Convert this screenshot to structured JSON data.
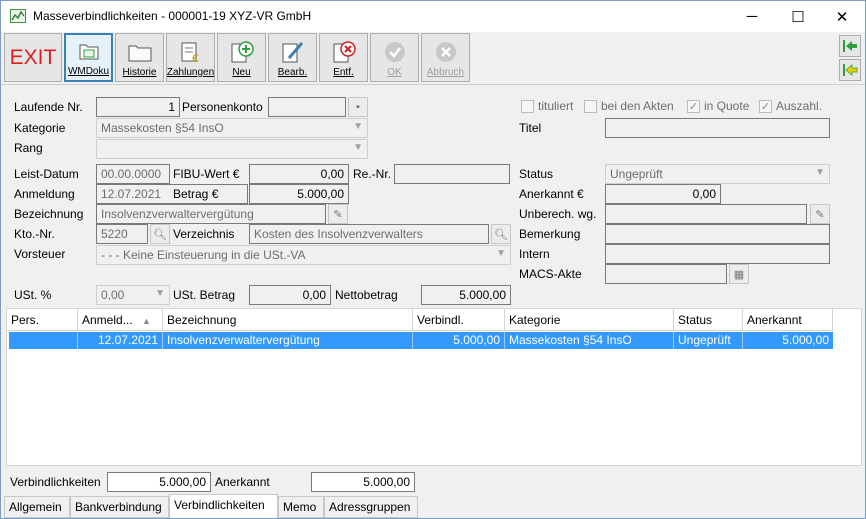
{
  "window": {
    "title": "Masseverbindlichkeiten - 000001-19 XYZ-VR GmbH",
    "minimize": "─",
    "maximize": "☐",
    "close": "✕"
  },
  "toolbar": {
    "exit_label": "EXIT",
    "buttons": [
      {
        "label": "WMDoku",
        "icon": "folder-icon"
      },
      {
        "label": "Historie",
        "icon": "history-icon"
      },
      {
        "label": "Zahlungen",
        "icon": "payments-icon"
      },
      {
        "label": "Neu",
        "icon": "add-icon"
      },
      {
        "label": "Bearb.",
        "icon": "edit-icon"
      },
      {
        "label": "Entf.",
        "icon": "delete-icon"
      },
      {
        "label": "OK",
        "icon": "ok-icon"
      },
      {
        "label": "Abbruch",
        "icon": "cancel-icon"
      }
    ]
  },
  "form": {
    "laufende_nr_label": "Laufende Nr.",
    "laufende_nr": "1",
    "personenkonto_label": "Personenkonto",
    "personenkonto": "",
    "tituliert_label": "tituliert",
    "bei_den_akten_label": "bei den Akten",
    "in_quote_label": "in Quote",
    "auszahl_label": "Auszahl.",
    "kategorie_label": "Kategorie",
    "kategorie": "Massekosten §54 InsO",
    "titel_label": "Titel",
    "titel": "",
    "rang_label": "Rang",
    "rang": "",
    "leist_datum_label": "Leist-Datum",
    "leist_datum": "00.00.0000",
    "fibu_wert_label": "FIBU-Wert €",
    "fibu_wert": "0,00",
    "re_nr_label": "Re.-Nr.",
    "re_nr": "",
    "status_label": "Status",
    "status": "Ungeprüft",
    "anmeldung_label": "Anmeldung",
    "anmeldung": "12.07.2021",
    "betrag_label": "Betrag €",
    "betrag": "5.000,00",
    "anerkannt_label": "Anerkannt €",
    "anerkannt": "0,00",
    "bezeichnung_label": "Bezeichnung",
    "bezeichnung": "Insolvenzverwaltervergütung",
    "unberech_label": "Unberech. wg.",
    "unberech": "",
    "kto_nr_label": "Kto.-Nr.",
    "kto_nr": "5220",
    "verzeichnis_label": "Verzeichnis",
    "verzeichnis": "Kosten des Insolvenzverwalters",
    "bemerkung_label": "Bemerkung",
    "bemerkung": "",
    "vorsteuer_label": "Vorsteuer",
    "vorsteuer": "- - - Keine Einsteuerung in die USt.-VA",
    "intern_label": "Intern",
    "intern": "",
    "macs_akte_label": "MACS-Akte",
    "macs_akte": "",
    "ust_pct_label": "USt. %",
    "ust_pct": "0,00",
    "ust_betrag_label": "USt. Betrag",
    "ust_betrag": "0,00",
    "nettobetrag_label": "Nettobetrag",
    "nettobetrag": "5.000,00"
  },
  "table": {
    "columns": [
      "Pers.",
      "Anmeld...",
      "Bezeichnung",
      "Verbindl.",
      "Kategorie",
      "Status",
      "Anerkannt"
    ],
    "sort_indicator": "▲",
    "rows": [
      [
        "",
        "12.07.2021",
        "Insolvenzverwaltervergütung",
        "5.000,00",
        "Massekosten §54 InsO",
        "Ungeprüft",
        "5.000,00"
      ]
    ]
  },
  "footer": {
    "verbindlichkeiten_label": "Verbindlichkeiten",
    "verbindlichkeiten": "5.000,00",
    "anerkannt_label": "Anerkannt",
    "anerkannt": "5.000,00"
  },
  "tabs": [
    "Allgemein",
    "Bankverbindung",
    "Verbindlichkeiten",
    "Memo",
    "Adressgruppen"
  ],
  "colors": {
    "selection": "#3399ff",
    "exit": "#e01e1e",
    "add": "#2e9e3e",
    "delete": "#d32020"
  }
}
